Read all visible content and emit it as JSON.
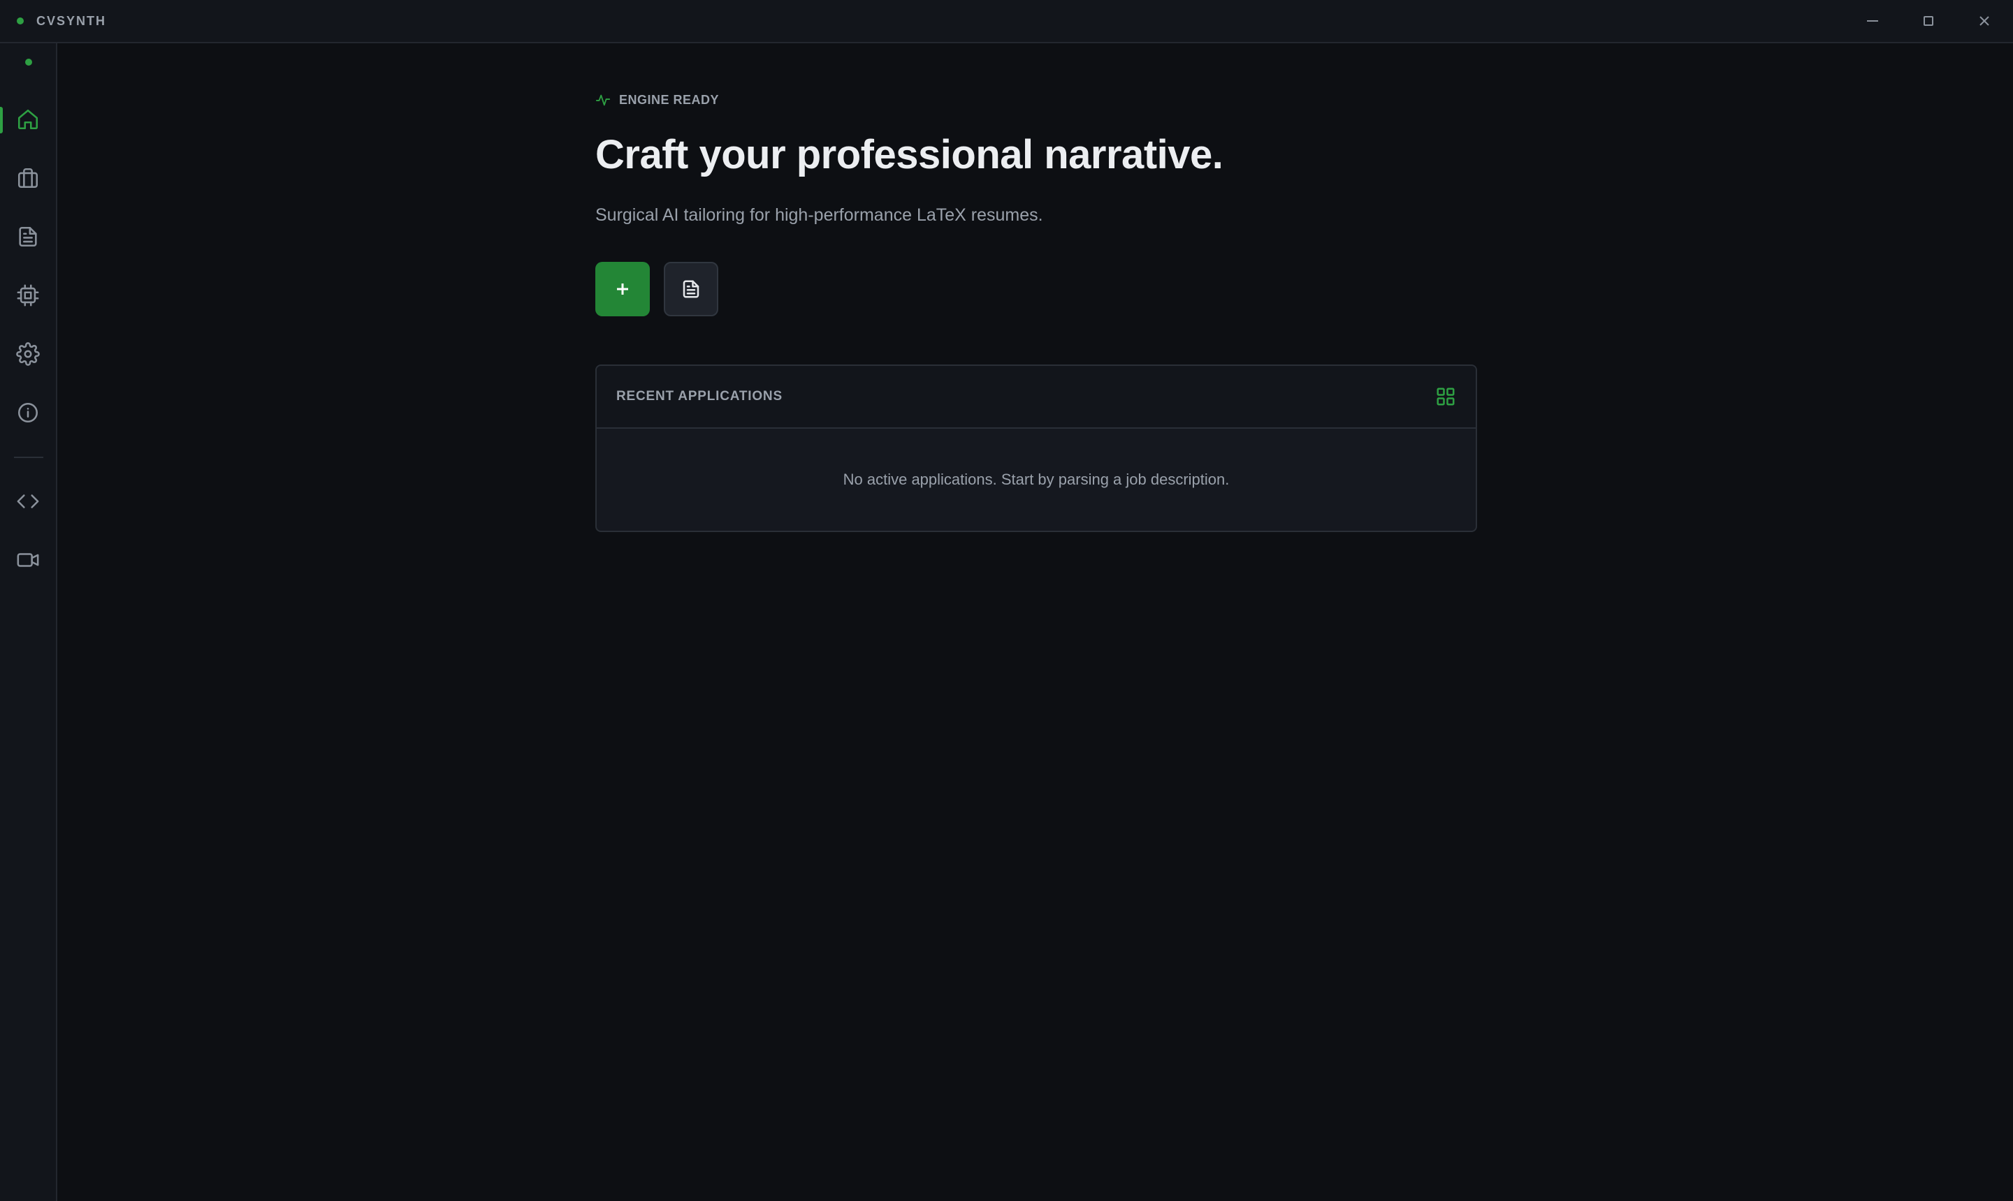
{
  "app": {
    "title": "CVSYNTH"
  },
  "window_controls": {
    "minimize_icon": "minimize-icon",
    "maximize_icon": "maximize-icon",
    "close_icon": "close-icon"
  },
  "sidebar": {
    "items": [
      {
        "name": "home",
        "icon": "home-icon",
        "active": true
      },
      {
        "name": "jobs",
        "icon": "briefcase-icon",
        "active": false
      },
      {
        "name": "documents",
        "icon": "document-icon",
        "active": false
      },
      {
        "name": "engine",
        "icon": "cpu-icon",
        "active": false
      },
      {
        "name": "settings",
        "icon": "gear-icon",
        "active": false
      },
      {
        "name": "about",
        "icon": "info-icon",
        "active": false
      },
      {
        "name": "code",
        "icon": "code-icon",
        "active": false
      },
      {
        "name": "video",
        "icon": "video-icon",
        "active": false
      }
    ]
  },
  "main": {
    "status": "ENGINE READY",
    "headline": "Craft your professional narrative.",
    "subheadline": "Surgical AI tailoring for high-performance LaTeX resumes.",
    "primary_action_icon": "plus-icon",
    "secondary_action_icon": "document-icon"
  },
  "recent_applications": {
    "title": "RECENT APPLICATIONS",
    "empty_message": "No active applications. Start by parsing a job description.",
    "grid_icon": "grid-icon"
  },
  "colors": {
    "accent": "#2ea043",
    "background": "#0d0f13",
    "panel": "#15181f"
  }
}
